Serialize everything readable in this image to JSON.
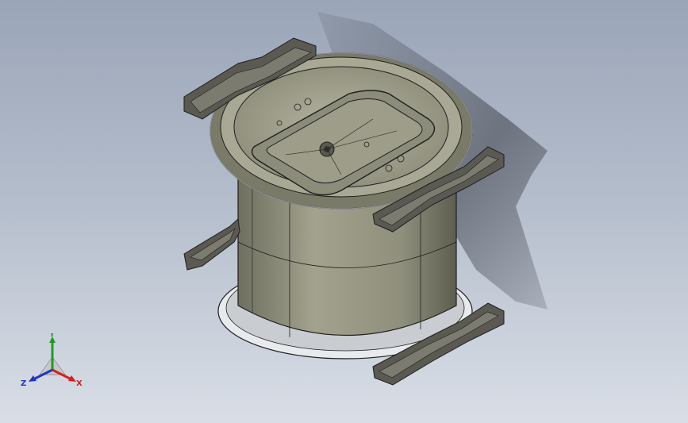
{
  "viewport": {
    "background_top": "#9aa5b8",
    "background_bottom": "#d9dee6"
  },
  "model": {
    "body_color": "#8f8f7c",
    "body_shade": "#6f6f60",
    "bracket_color": "#5a5a52",
    "edge_color": "#1e1e1e",
    "shadow_color": "#4a4f58"
  },
  "triad": {
    "x_label": "X",
    "y_label": "Y",
    "z_label": "Z",
    "x_color": "#d42020",
    "y_color": "#1f9a2a",
    "z_color": "#2035c8"
  }
}
